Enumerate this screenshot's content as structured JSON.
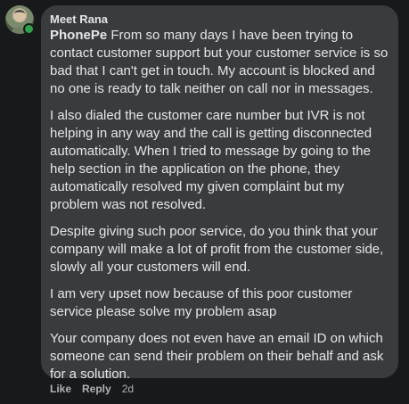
{
  "comment": {
    "author": "Meet Rana",
    "mention": "PhonePe",
    "paragraphs": [
      " From so many days I have been trying to contact customer support but your customer service is so bad that I can't get in touch. My account is blocked and no one is ready to talk neither on call nor in messages.",
      "I also dialed the customer care number but IVR is not helping in any way and the call is getting disconnected automatically. When I tried to message by going to the help section in the application on the phone, they automatically resolved my given complaint but my problem was not resolved.",
      "Despite giving such poor service, do you think that your company will make a lot of profit from the customer side, slowly all your customers will end.",
      "I am very upset now because of this poor customer service please solve my problem asap",
      "Your company does not even have an email ID on which someone can send their problem on their behalf and ask for a solution."
    ],
    "actions": {
      "like": "Like",
      "reply": "Reply",
      "time": "2d"
    }
  },
  "colors": {
    "background": "#18191a",
    "bubble": "#3a3b3c",
    "text": "#e4e6eb",
    "secondary_text": "#b0b3b8",
    "online": "#31a24c"
  }
}
